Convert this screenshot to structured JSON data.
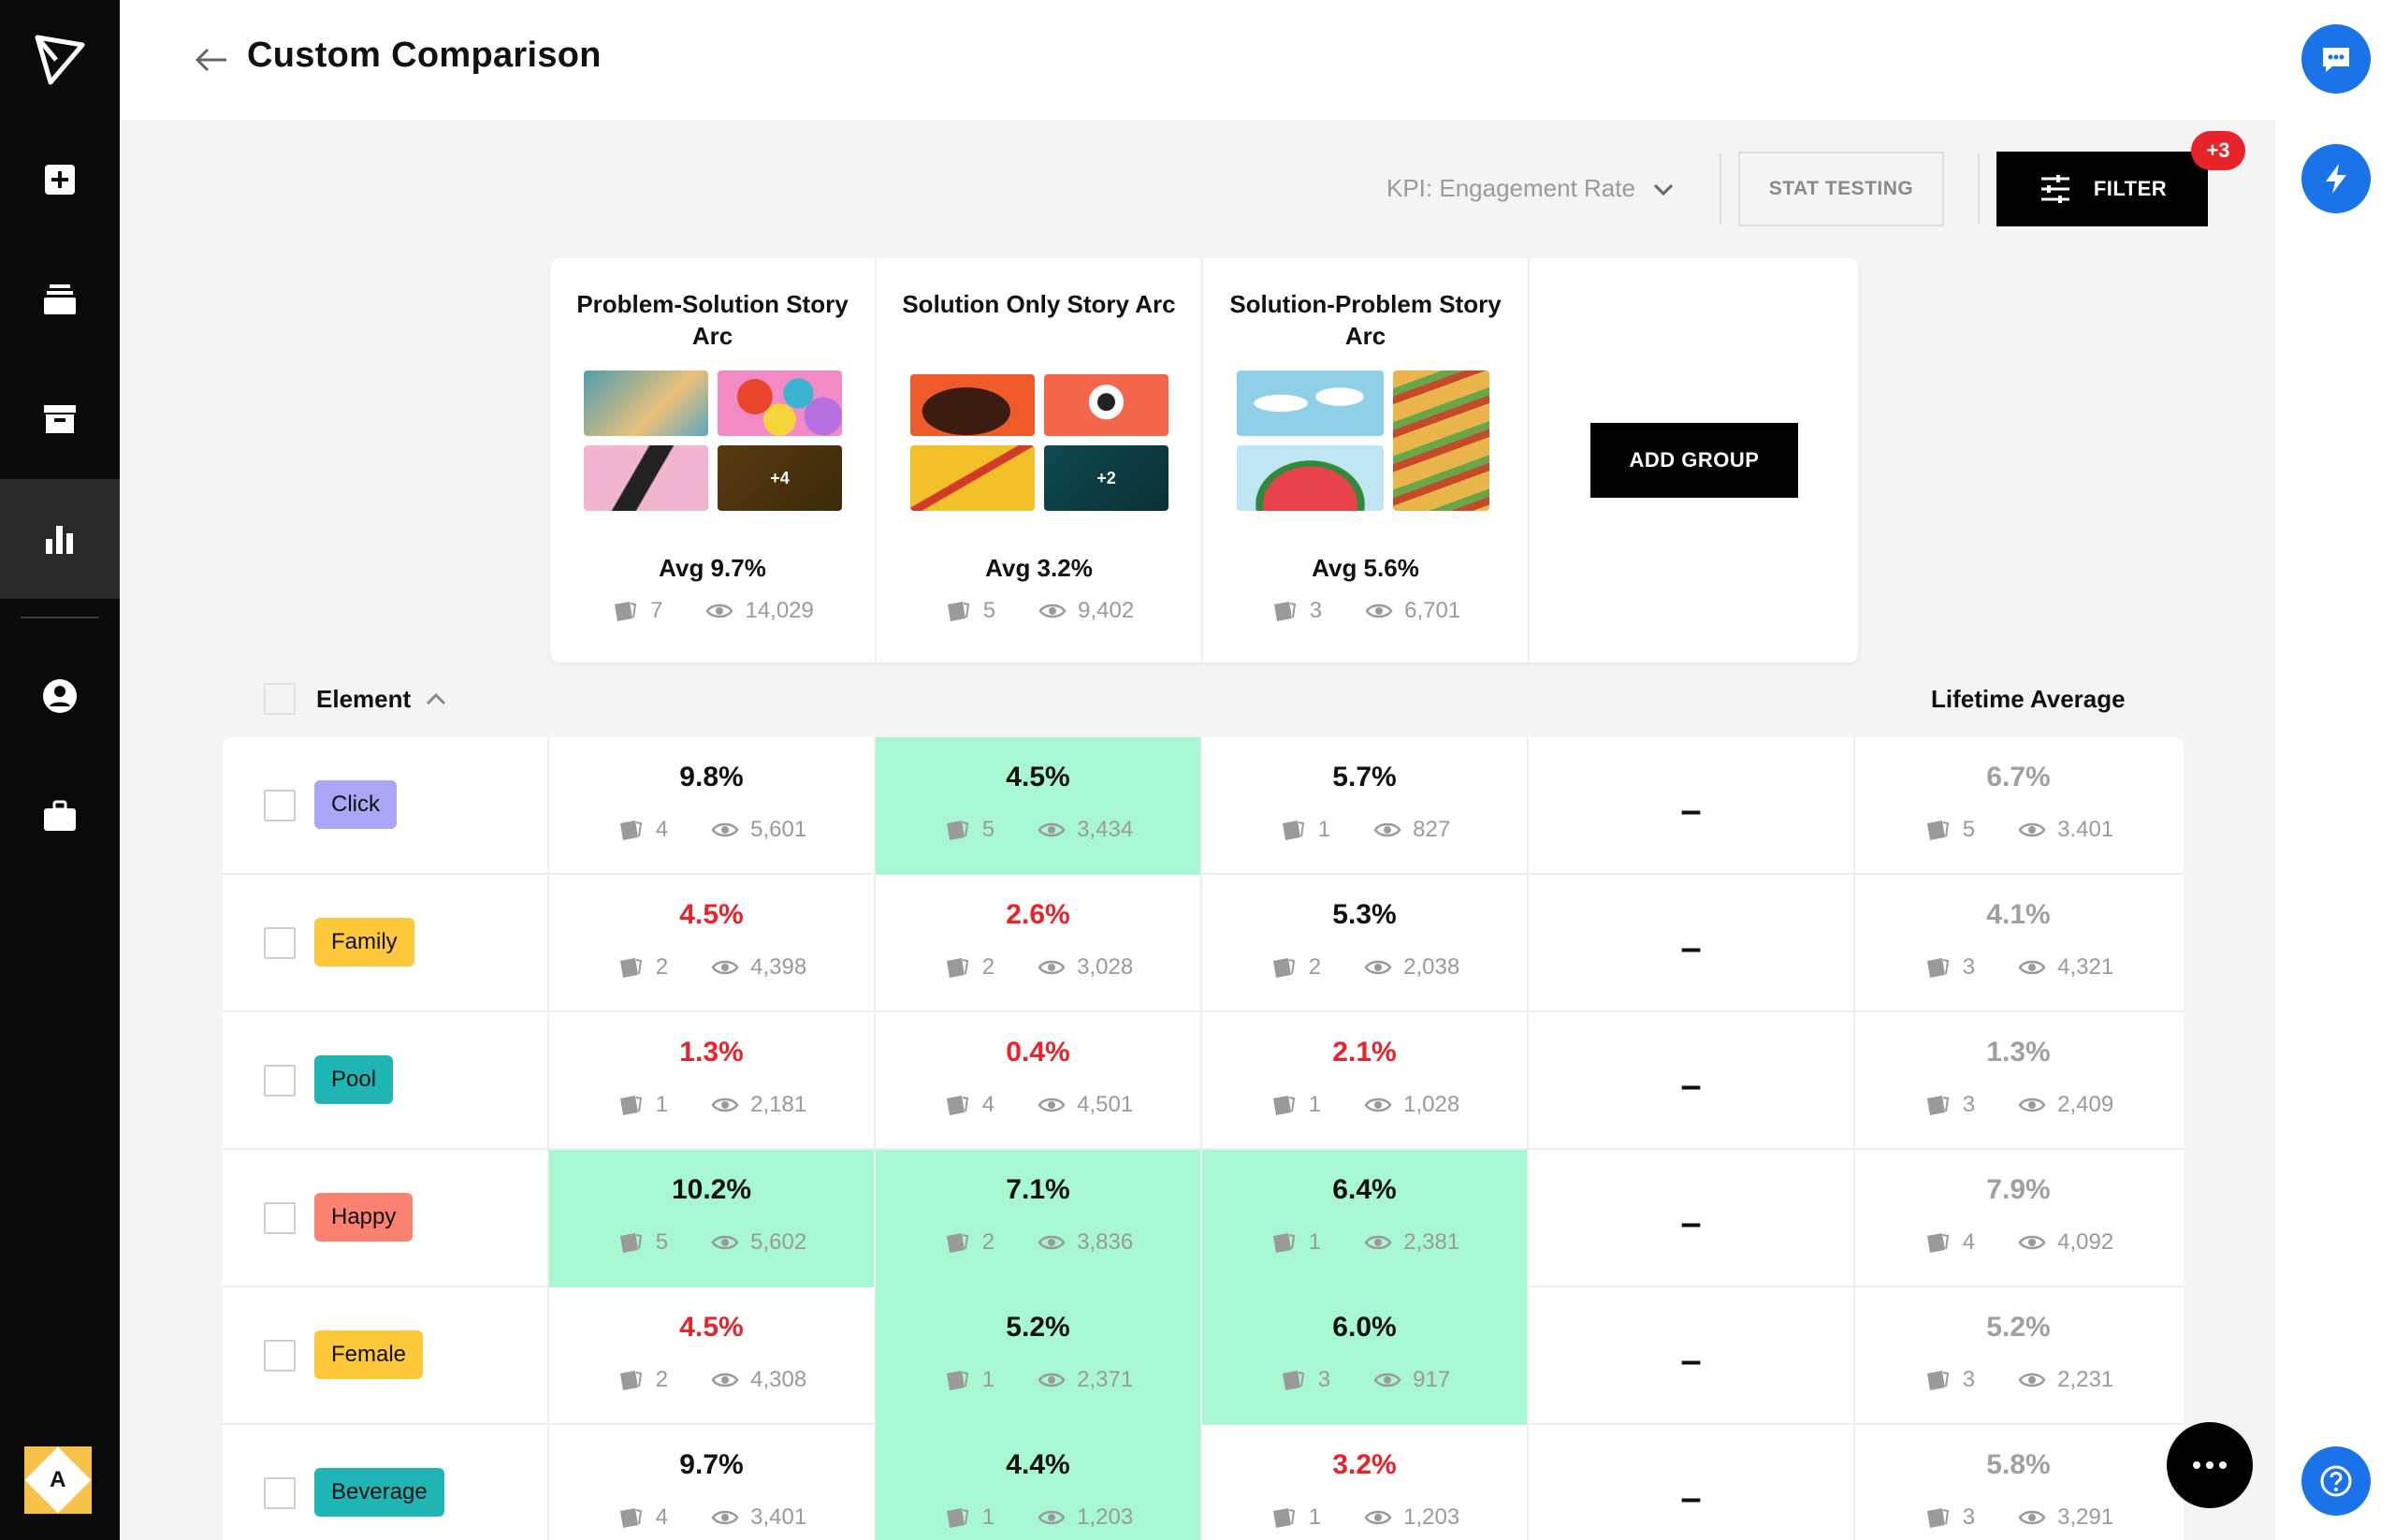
{
  "header": {
    "title": "Custom Comparison"
  },
  "toolbar": {
    "kpi_label": "KPI: Engagement Rate",
    "stat_testing_label": "STAT TESTING",
    "filter_label": "FILTER",
    "filter_badge": "+3"
  },
  "user": {
    "avatar_letter": "A"
  },
  "groups": [
    {
      "title": "Problem-Solution Story Arc",
      "avg": "Avg 9.7%",
      "creatives": "7",
      "views": "14,029",
      "more": "+4"
    },
    {
      "title": "Solution Only Story Arc",
      "avg": "Avg 3.2%",
      "creatives": "5",
      "views": "9,402",
      "more": "+2"
    },
    {
      "title": "Solution-Problem Story Arc",
      "avg": "Avg 5.6%",
      "creatives": "3",
      "views": "6,701",
      "more": ""
    }
  ],
  "add_group_label": "ADD GROUP",
  "table": {
    "element_header": "Element",
    "lifetime_header": "Lifetime Average",
    "empty_cell": "–",
    "rows": [
      {
        "label": "Click",
        "tag_color": "#a9a6f5",
        "cells": [
          {
            "value": "9.8%",
            "creatives": "4",
            "views": "5,601",
            "status": "neutral"
          },
          {
            "value": "4.5%",
            "creatives": "5",
            "views": "3,434",
            "status": "highlight"
          },
          {
            "value": "5.7%",
            "creatives": "1",
            "views": "827",
            "status": "neutral"
          }
        ],
        "lifetime": {
          "value": "6.7%",
          "creatives": "5",
          "views": "3.401"
        }
      },
      {
        "label": "Family",
        "tag_color": "#fdc93a",
        "cells": [
          {
            "value": "4.5%",
            "creatives": "2",
            "views": "4,398",
            "status": "low"
          },
          {
            "value": "2.6%",
            "creatives": "2",
            "views": "3,028",
            "status": "low"
          },
          {
            "value": "5.3%",
            "creatives": "2",
            "views": "2,038",
            "status": "neutral"
          }
        ],
        "lifetime": {
          "value": "4.1%",
          "creatives": "3",
          "views": "4,321"
        }
      },
      {
        "label": "Pool",
        "tag_color": "#1fb5b5",
        "cells": [
          {
            "value": "1.3%",
            "creatives": "1",
            "views": "2,181",
            "status": "low"
          },
          {
            "value": "0.4%",
            "creatives": "4",
            "views": "4,501",
            "status": "low"
          },
          {
            "value": "2.1%",
            "creatives": "1",
            "views": "1,028",
            "status": "low"
          }
        ],
        "lifetime": {
          "value": "1.3%",
          "creatives": "3",
          "views": "2,409"
        }
      },
      {
        "label": "Happy",
        "tag_color": "#fb8270",
        "cells": [
          {
            "value": "10.2%",
            "creatives": "5",
            "views": "5,602",
            "status": "highlight"
          },
          {
            "value": "7.1%",
            "creatives": "2",
            "views": "3,836",
            "status": "highlight"
          },
          {
            "value": "6.4%",
            "creatives": "1",
            "views": "2,381",
            "status": "highlight"
          }
        ],
        "lifetime": {
          "value": "7.9%",
          "creatives": "4",
          "views": "4,092"
        }
      },
      {
        "label": "Female",
        "tag_color": "#fdc93a",
        "cells": [
          {
            "value": "4.5%",
            "creatives": "2",
            "views": "4,308",
            "status": "low"
          },
          {
            "value": "5.2%",
            "creatives": "1",
            "views": "2,371",
            "status": "highlight"
          },
          {
            "value": "6.0%",
            "creatives": "3",
            "views": "917",
            "status": "highlight"
          }
        ],
        "lifetime": {
          "value": "5.2%",
          "creatives": "3",
          "views": "2,231"
        }
      },
      {
        "label": "Beverage",
        "tag_color": "#1fb5b5",
        "cells": [
          {
            "value": "9.7%",
            "creatives": "4",
            "views": "3,401",
            "status": "neutral"
          },
          {
            "value": "4.4%",
            "creatives": "1",
            "views": "1,203",
            "status": "highlight"
          },
          {
            "value": "3.2%",
            "creatives": "1",
            "views": "1,203",
            "status": "low"
          }
        ],
        "lifetime": {
          "value": "5.8%",
          "creatives": "3",
          "views": "3,291"
        }
      }
    ]
  },
  "colors": {
    "highlight": "#a7f7d3",
    "low_text": "#e8232a",
    "accent_blue": "#1a73e8"
  },
  "icons": [
    "logo-icon",
    "add-icon",
    "layers-icon",
    "archive-icon",
    "chart-icon",
    "user-icon",
    "briefcase-icon",
    "back-arrow-icon",
    "chevron-down-icon",
    "sliders-icon",
    "chevron-up-icon",
    "creative-icon",
    "eye-icon",
    "chat-icon",
    "lightning-icon",
    "help-icon",
    "more-icon"
  ]
}
